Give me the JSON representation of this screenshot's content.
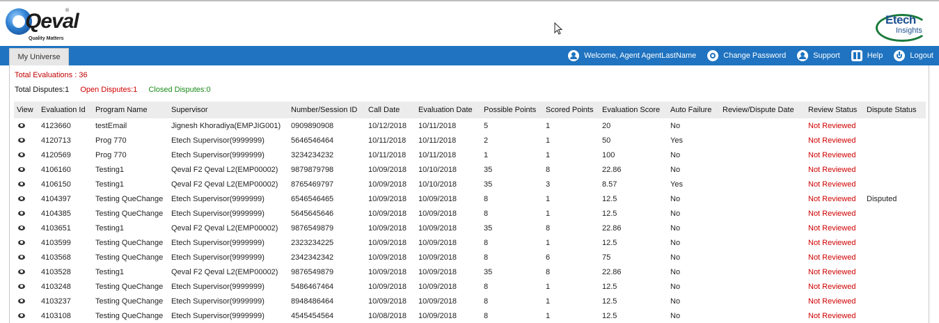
{
  "header": {
    "logo_left": {
      "word": "Qeval",
      "registered": "®",
      "tagline": "Quality Matters",
      "icon": "qeval-logo-icon"
    },
    "logo_right": {
      "line1": "Etech",
      "line2": "Insights",
      "icon": "etech-logo-icon"
    }
  },
  "nav": {
    "tab": "My Universe",
    "items": [
      {
        "label": "Welcome, Agent AgentLastName",
        "icon": "user-icon"
      },
      {
        "label": "Change Password",
        "icon": "gear-icon"
      },
      {
        "label": "Support",
        "icon": "support-icon"
      },
      {
        "label": "Help",
        "icon": "help-book-icon"
      },
      {
        "label": "Logout",
        "icon": "power-icon"
      }
    ]
  },
  "summary": {
    "total_evaluations": "Total Evaluations : 36",
    "total_disputes": "Total Disputes:1",
    "open_disputes": "Open Disputes:1",
    "closed_disputes": "Closed Disputes:0"
  },
  "colors": {
    "nav_bg": "#1f73c0",
    "not_reviewed": "#d00000",
    "total_evaluations": "#c00000",
    "open_disputes": "#d00000",
    "closed_disputes": "#1a8a1a"
  },
  "table": {
    "columns": [
      "View",
      "Evaluation Id",
      "Program Name",
      "Supervisor",
      "Number/Session ID",
      "Call Date",
      "Evaluation Date",
      "Possible Points",
      "Scored Points",
      "Evaluation Score",
      "Auto Failure",
      "Review/Dispute Date",
      "Review Status",
      "Dispute Status"
    ],
    "rows": [
      {
        "id": "4123660",
        "program": "testEmail",
        "supervisor": "Jignesh Khoradiya(EMPJIG001)",
        "number": "0909890908",
        "call_date": "10/12/2018",
        "eval_date": "10/11/2018",
        "possible": "5",
        "scored": "1",
        "score": "20",
        "auto_failure": "No",
        "review_date": "",
        "review_status": "Not Reviewed",
        "dispute_status": ""
      },
      {
        "id": "4120713",
        "program": "Prog 770",
        "supervisor": "Etech Supervisor(9999999)",
        "number": "5646546464",
        "call_date": "10/11/2018",
        "eval_date": "10/11/2018",
        "possible": "2",
        "scored": "1",
        "score": "50",
        "auto_failure": "Yes",
        "review_date": "",
        "review_status": "Not Reviewed",
        "dispute_status": ""
      },
      {
        "id": "4120569",
        "program": "Prog 770",
        "supervisor": "Etech Supervisor(9999999)",
        "number": "3234234232",
        "call_date": "10/11/2018",
        "eval_date": "10/11/2018",
        "possible": "1",
        "scored": "1",
        "score": "100",
        "auto_failure": "No",
        "review_date": "",
        "review_status": "Not Reviewed",
        "dispute_status": ""
      },
      {
        "id": "4106160",
        "program": "Testing1",
        "supervisor": "Qeval F2 Qeval L2(EMP00002)",
        "number": "9879879798",
        "call_date": "10/09/2018",
        "eval_date": "10/10/2018",
        "possible": "35",
        "scored": "8",
        "score": "22.86",
        "auto_failure": "No",
        "review_date": "",
        "review_status": "Not Reviewed",
        "dispute_status": ""
      },
      {
        "id": "4106150",
        "program": "Testing1",
        "supervisor": "Qeval F2 Qeval L2(EMP00002)",
        "number": "8765469797",
        "call_date": "10/09/2018",
        "eval_date": "10/10/2018",
        "possible": "35",
        "scored": "3",
        "score": "8.57",
        "auto_failure": "Yes",
        "review_date": "",
        "review_status": "Not Reviewed",
        "dispute_status": ""
      },
      {
        "id": "4104397",
        "program": "Testing QueChange",
        "supervisor": "Etech Supervisor(9999999)",
        "number": "6546546465",
        "call_date": "10/09/2018",
        "eval_date": "10/09/2018",
        "possible": "8",
        "scored": "1",
        "score": "12.5",
        "auto_failure": "No",
        "review_date": "",
        "review_status": "Not Reviewed",
        "dispute_status": "Disputed"
      },
      {
        "id": "4104385",
        "program": "Testing QueChange",
        "supervisor": "Etech Supervisor(9999999)",
        "number": "5645645646",
        "call_date": "10/09/2018",
        "eval_date": "10/09/2018",
        "possible": "8",
        "scored": "1",
        "score": "12.5",
        "auto_failure": "No",
        "review_date": "",
        "review_status": "Not Reviewed",
        "dispute_status": ""
      },
      {
        "id": "4103651",
        "program": "Testing1",
        "supervisor": "Qeval F2 Qeval L2(EMP00002)",
        "number": "9876549879",
        "call_date": "10/09/2018",
        "eval_date": "10/09/2018",
        "possible": "35",
        "scored": "8",
        "score": "22.86",
        "auto_failure": "No",
        "review_date": "",
        "review_status": "Not Reviewed",
        "dispute_status": ""
      },
      {
        "id": "4103599",
        "program": "Testing QueChange",
        "supervisor": "Etech Supervisor(9999999)",
        "number": "2323234225",
        "call_date": "10/09/2018",
        "eval_date": "10/09/2018",
        "possible": "8",
        "scored": "1",
        "score": "12.5",
        "auto_failure": "No",
        "review_date": "",
        "review_status": "Not Reviewed",
        "dispute_status": ""
      },
      {
        "id": "4103568",
        "program": "Testing QueChange",
        "supervisor": "Etech Supervisor(9999999)",
        "number": "2342342342",
        "call_date": "10/09/2018",
        "eval_date": "10/09/2018",
        "possible": "8",
        "scored": "6",
        "score": "75",
        "auto_failure": "No",
        "review_date": "",
        "review_status": "Not Reviewed",
        "dispute_status": ""
      },
      {
        "id": "4103528",
        "program": "Testing1",
        "supervisor": "Qeval F2 Qeval L2(EMP00002)",
        "number": "9876549879",
        "call_date": "10/09/2018",
        "eval_date": "10/09/2018",
        "possible": "35",
        "scored": "8",
        "score": "22.86",
        "auto_failure": "No",
        "review_date": "",
        "review_status": "Not Reviewed",
        "dispute_status": ""
      },
      {
        "id": "4103248",
        "program": "Testing QueChange",
        "supervisor": "Etech Supervisor(9999999)",
        "number": "5486467464",
        "call_date": "10/09/2018",
        "eval_date": "10/09/2018",
        "possible": "8",
        "scored": "1",
        "score": "12.5",
        "auto_failure": "No",
        "review_date": "",
        "review_status": "Not Reviewed",
        "dispute_status": ""
      },
      {
        "id": "4103237",
        "program": "Testing QueChange",
        "supervisor": "Etech Supervisor(9999999)",
        "number": "8948486464",
        "call_date": "10/09/2018",
        "eval_date": "10/09/2018",
        "possible": "8",
        "scored": "1",
        "score": "12.5",
        "auto_failure": "No",
        "review_date": "",
        "review_status": "Not Reviewed",
        "dispute_status": ""
      },
      {
        "id": "4103108",
        "program": "Testing QueChange",
        "supervisor": "Etech Supervisor(9999999)",
        "number": "4545454564",
        "call_date": "10/08/2018",
        "eval_date": "10/09/2018",
        "possible": "8",
        "scored": "1",
        "score": "12.5",
        "auto_failure": "No",
        "review_date": "",
        "review_status": "Not Reviewed",
        "dispute_status": ""
      }
    ]
  }
}
